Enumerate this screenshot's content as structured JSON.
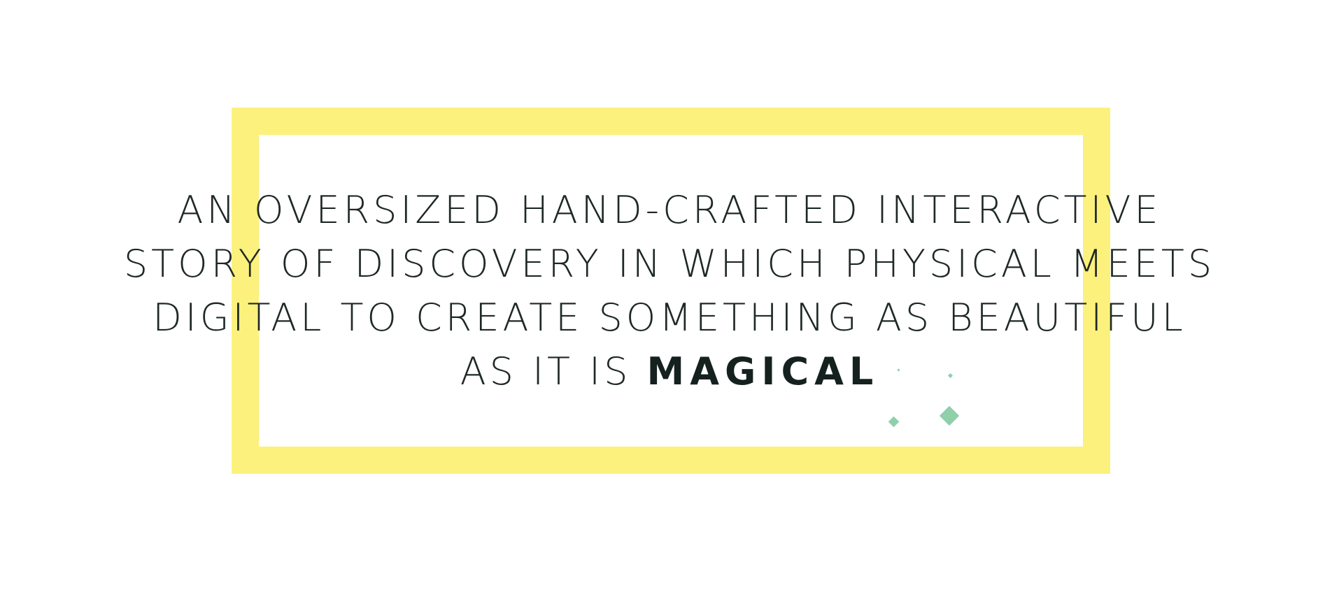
{
  "headline": {
    "line1": "AN OVERSIZED HAND-CRAFTED INTERACTIVE",
    "line2": "STORY OF DISCOVERY IN WHICH PHYSICAL MEETS",
    "line3": "DIGITAL TO CREATE SOMETHING AS BEAUTIFUL",
    "line4_prefix": "AS IT IS",
    "line4_emphasis": "MAGICAL"
  },
  "colors": {
    "frame": "#fcf17c",
    "text": "#1e2826",
    "sparkle": "#8fcfaa",
    "background": "#ffffff"
  },
  "decorations": [
    "sparkle-icon",
    "sparkle-icon",
    "sparkle-icon",
    "sparkle-icon"
  ]
}
